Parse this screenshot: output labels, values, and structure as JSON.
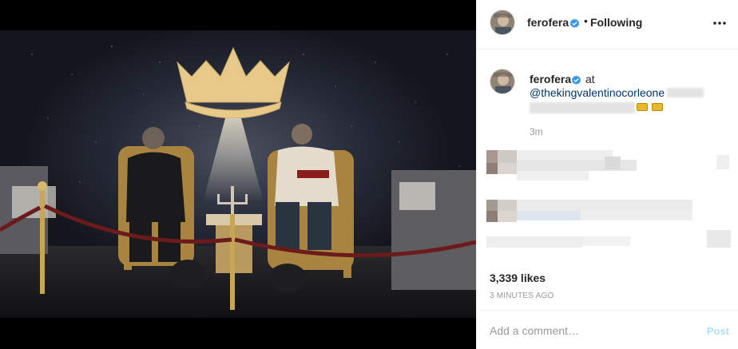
{
  "post": {
    "username": "ferofera",
    "verified": true,
    "follow_status": "Following",
    "separator": "•"
  },
  "caption": {
    "username": "ferofera",
    "at_word": "at",
    "mention": "@thekingvalentinocorleone",
    "time_ago": "3m"
  },
  "likes": "3,339 likes",
  "timestamp": "3 MINUTES AGO",
  "comment_bar": {
    "placeholder": "Add a comment…",
    "post_label": "Post"
  },
  "icons": {
    "verified": "verified-badge-icon",
    "more": "more-options-icon",
    "emoji": "crown-emoji-icon"
  },
  "colors": {
    "verified_blue": "#3897f0",
    "mention_link": "#003569",
    "post_disabled": "#b2dffc",
    "crown_gold": "#e8c98a"
  }
}
